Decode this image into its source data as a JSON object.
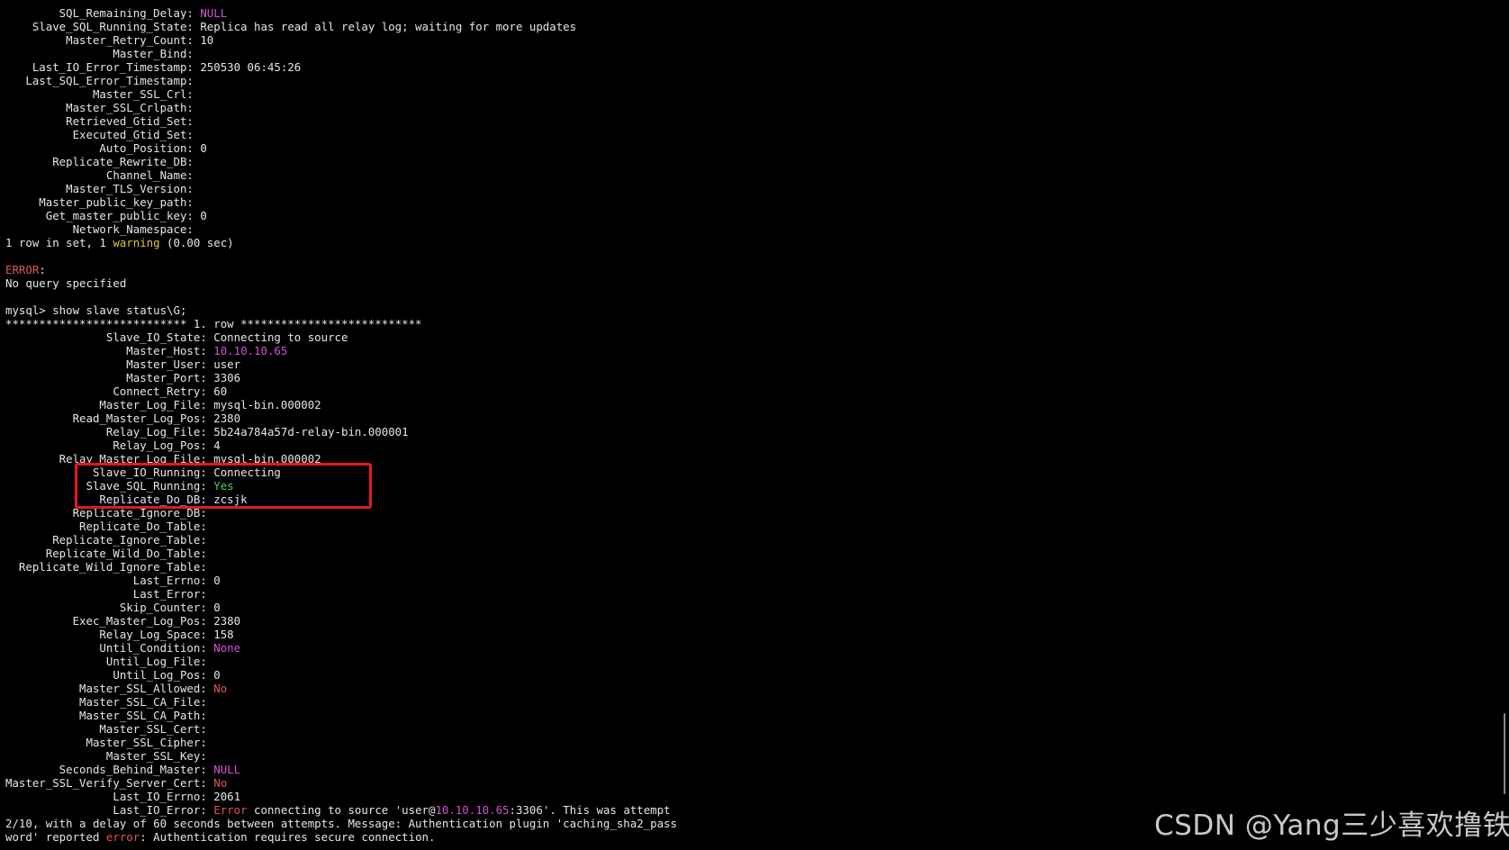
{
  "terminal": {
    "lines": [
      {
        "label": "        SQL_Remaining_Delay: ",
        "value": "NULL",
        "value_color": "magenta"
      },
      {
        "label": "    Slave_SQL_Running_State: ",
        "value": "Replica has read all relay log; waiting for more updates"
      },
      {
        "label": "         Master_Retry_Count: ",
        "value": "10"
      },
      {
        "label": "                Master_Bind: ",
        "value": ""
      },
      {
        "label": "    Last_IO_Error_Timestamp: ",
        "value": "250530 06:45:26"
      },
      {
        "label": "   Last_SQL_Error_Timestamp: ",
        "value": ""
      },
      {
        "label": "             Master_SSL_Crl: ",
        "value": ""
      },
      {
        "label": "         Master_SSL_Crlpath: ",
        "value": ""
      },
      {
        "label": "         Retrieved_Gtid_Set: ",
        "value": ""
      },
      {
        "label": "          Executed_Gtid_Set: ",
        "value": ""
      },
      {
        "label": "              Auto_Position: ",
        "value": "0"
      },
      {
        "label": "       Replicate_Rewrite_DB: ",
        "value": ""
      },
      {
        "label": "               Channel_Name: ",
        "value": ""
      },
      {
        "label": "         Master_TLS_Version: ",
        "value": ""
      },
      {
        "label": "     Master_public_key_path: ",
        "value": ""
      },
      {
        "label": "      Get_master_public_key: ",
        "value": "0"
      },
      {
        "label": "          Network_Namespace: ",
        "value": ""
      },
      {
        "label": "1 row in set, 1 ",
        "value": "warning",
        "value_color": "yellow",
        "suffix": " (0.00 sec)"
      },
      {
        "label": "",
        "value": ""
      },
      {
        "label": "",
        "value": "ERROR",
        "value_color": "red",
        "suffix": ":"
      },
      {
        "label": "No query specified",
        "value": ""
      },
      {
        "label": "",
        "value": ""
      },
      {
        "label": "mysql> show slave status\\G;",
        "value": ""
      },
      {
        "label": "*************************** 1. row ***************************",
        "value": ""
      },
      {
        "label": "               Slave_IO_State: ",
        "value": "Connecting to source"
      },
      {
        "label": "                  Master_Host: ",
        "value": "10.10.10.65",
        "value_color": "magenta"
      },
      {
        "label": "                  Master_User: ",
        "value": "user"
      },
      {
        "label": "                  Master_Port: ",
        "value": "3306"
      },
      {
        "label": "                Connect_Retry: ",
        "value": "60"
      },
      {
        "label": "              Master_Log_File: ",
        "value": "mysql-bin.000002"
      },
      {
        "label": "          Read_Master_Log_Pos: ",
        "value": "2380"
      },
      {
        "label": "               Relay_Log_File: ",
        "value": "5b24a784a57d-relay-bin.000001"
      },
      {
        "label": "                Relay_Log_Pos: ",
        "value": "4"
      },
      {
        "label": "        Relay_Master_Log_File: ",
        "value": "mysql-bin.000002"
      },
      {
        "label": "             Slave_IO_Running: ",
        "value": "Connecting"
      },
      {
        "label": "            Slave_SQL_Running: ",
        "value": "Yes",
        "value_color": "green"
      },
      {
        "label": "              Replicate_Do_DB: ",
        "value": "zcsjk"
      },
      {
        "label": "          Replicate_Ignore_DB: ",
        "value": ""
      },
      {
        "label": "           Replicate_Do_Table: ",
        "value": ""
      },
      {
        "label": "       Replicate_Ignore_Table: ",
        "value": ""
      },
      {
        "label": "      Replicate_Wild_Do_Table: ",
        "value": ""
      },
      {
        "label": "  Replicate_Wild_Ignore_Table: ",
        "value": ""
      },
      {
        "label": "                   Last_Errno: ",
        "value": "0"
      },
      {
        "label": "                   Last_Error: ",
        "value": ""
      },
      {
        "label": "                 Skip_Counter: ",
        "value": "0"
      },
      {
        "label": "          Exec_Master_Log_Pos: ",
        "value": "2380"
      },
      {
        "label": "              Relay_Log_Space: ",
        "value": "158"
      },
      {
        "label": "              Until_Condition: ",
        "value": "None",
        "value_color": "magenta"
      },
      {
        "label": "               Until_Log_File: ",
        "value": ""
      },
      {
        "label": "                Until_Log_Pos: ",
        "value": "0"
      },
      {
        "label": "           Master_SSL_Allowed: ",
        "value": "No",
        "value_color": "red"
      },
      {
        "label": "           Master_SSL_CA_File: ",
        "value": ""
      },
      {
        "label": "           Master_SSL_CA_Path: ",
        "value": ""
      },
      {
        "label": "              Master_SSL_Cert: ",
        "value": ""
      },
      {
        "label": "            Master_SSL_Cipher: ",
        "value": ""
      },
      {
        "label": "               Master_SSL_Key: ",
        "value": ""
      },
      {
        "label": "        Seconds_Behind_Master: ",
        "value": "NULL",
        "value_color": "magenta"
      },
      {
        "label": "Master_SSL_Verify_Server_Cert: ",
        "value": "No",
        "value_color": "red"
      },
      {
        "label": "                Last_IO_Errno: ",
        "value": "2061"
      },
      {
        "label": "                Last_IO_Error: ",
        "value": "Error",
        "value_color": "red",
        "suffix": " connecting to source 'user@",
        "value2": "10.10.10.65",
        "value2_color": "magenta",
        "suffix2": ":3306'. This was attempt"
      },
      {
        "label": "2/10, with a delay of 60 seconds between attempts. Message: Authentication plugin 'caching_sha2_pass",
        "value": ""
      },
      {
        "label": "word' reported ",
        "value": "error",
        "value_color": "red",
        "suffix": ": Authentication requires secure connection."
      }
    ]
  },
  "watermark": {
    "text": "CSDN @Yang三少喜欢撸铁"
  },
  "colors": {
    "background": "#000000",
    "text": "#e6e6e6",
    "magenta": "#d451d4",
    "red": "#e05555",
    "yellow": "#e3c43a",
    "green": "#45d45a",
    "highlight_box": "#e01b1b"
  }
}
